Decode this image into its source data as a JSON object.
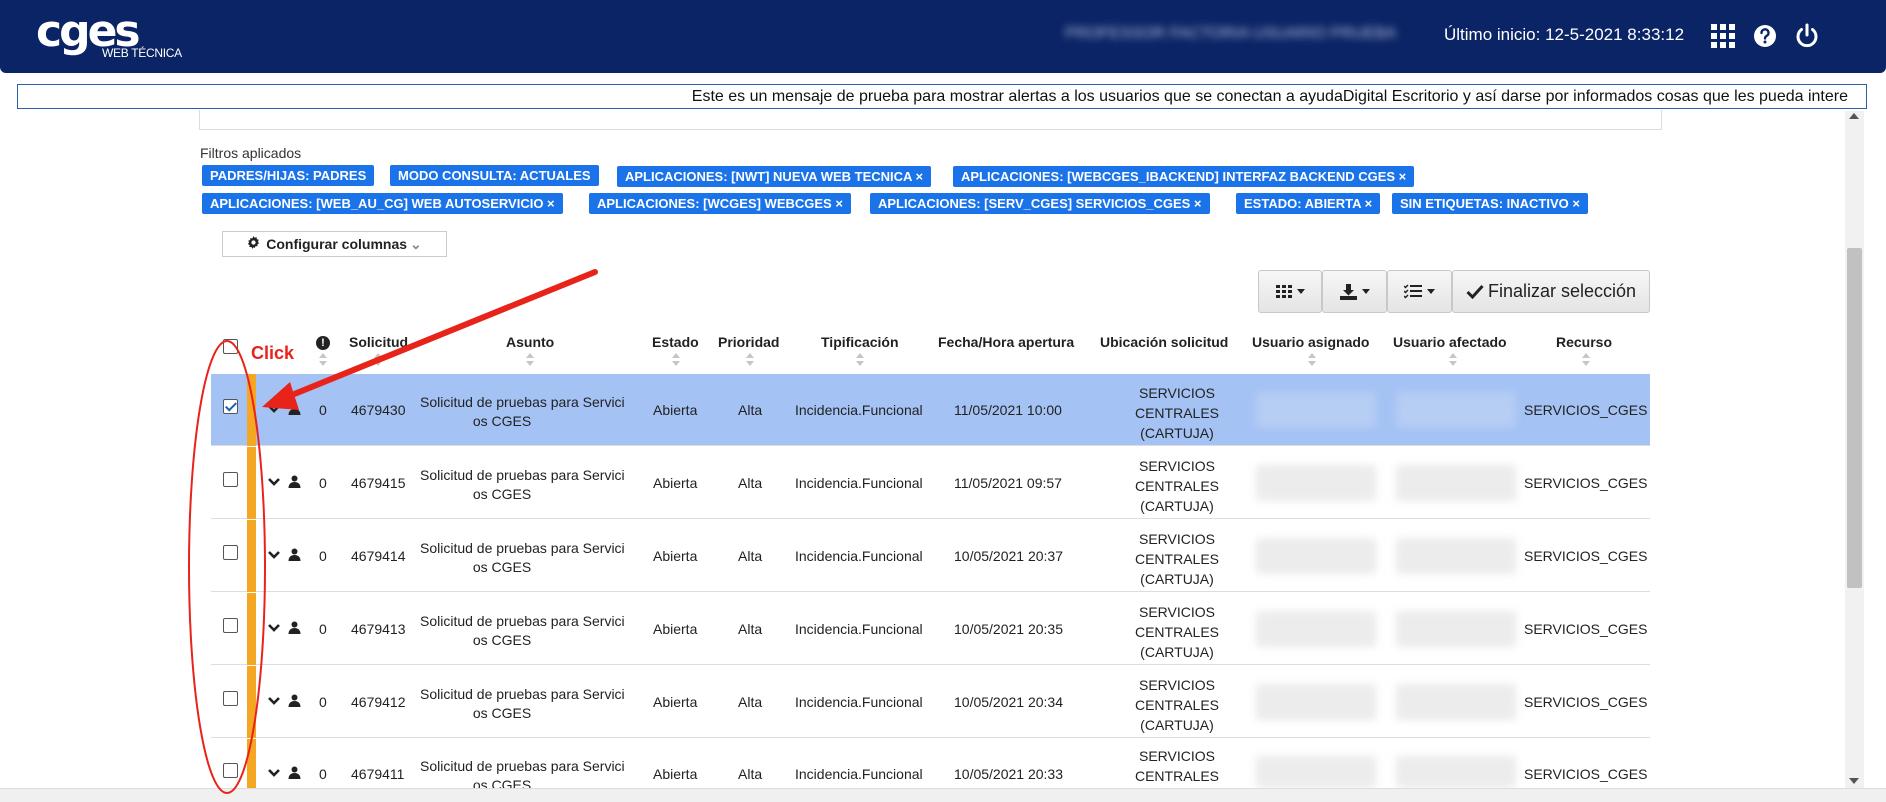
{
  "header": {
    "logo_main": "cges",
    "logo_sub": "WEB TÉCNICA",
    "user_name": "PROFESSOR FACTORIA USUARIO PRUEBA",
    "last_login": "Último inicio: 12-5-2021 8:33:12",
    "icons": [
      "apps-grid-icon",
      "help-icon",
      "power-icon"
    ]
  },
  "ticker": {
    "message": "Este es un mensaje de prueba para mostrar alertas a los usuarios que se conectan a ayudaDigital Escritorio y así darse por informados cosas que les pueda intere"
  },
  "filters": {
    "label": "Filtros aplicados",
    "chips": [
      "PADRES/HIJAS: PADRES",
      "MODO CONSULTA: ACTUALES",
      "APLICACIONES: [NWT] NUEVA WEB TECNICA ×",
      "APLICACIONES: [WEBCGES_IBACKEND] INTERFAZ BACKEND CGES ×",
      "APLICACIONES: [WEB_AU_CG] WEB AUTOSERVICIO ×",
      "APLICACIONES: [WCGES] WEBCGES ×",
      "APLICACIONES: [SERV_CGES] SERVICIOS_CGES ×",
      "ESTADO: ABIERTA ×",
      "SIN ETIQUETAS: INACTIVO ×"
    ]
  },
  "config_columns_label": "Configurar columnas",
  "toolbar": {
    "finalize_label": "Finalizar selección"
  },
  "table": {
    "columns": [
      "Solicitud",
      "Asunto",
      "Estado",
      "Prioridad",
      "Tipificación",
      "Fecha/Hora apertura",
      "Ubicación solicitud",
      "Usuario asignado",
      "Usuario afectado",
      "Recurso"
    ],
    "rows": [
      {
        "count": "0",
        "id": "4679430",
        "asunto_1": "Solicitud de pruebas para Servici",
        "asunto_2": "os CGES",
        "estado": "Abierta",
        "prioridad": "Alta",
        "tipificacion": "Incidencia.Funcional",
        "fecha": "11/05/2021 10:00",
        "ubicacion_1": "SERVICIOS",
        "ubicacion_2": "CENTRALES",
        "ubicacion_3": "(CARTUJA)",
        "recurso": "SERVICIOS_CGES",
        "checked": true
      },
      {
        "count": "0",
        "id": "4679415",
        "asunto_1": "Solicitud de pruebas para Servici",
        "asunto_2": "os CGES",
        "estado": "Abierta",
        "prioridad": "Alta",
        "tipificacion": "Incidencia.Funcional",
        "fecha": "11/05/2021 09:57",
        "ubicacion_1": "SERVICIOS",
        "ubicacion_2": "CENTRALES",
        "ubicacion_3": "(CARTUJA)",
        "recurso": "SERVICIOS_CGES",
        "checked": false
      },
      {
        "count": "0",
        "id": "4679414",
        "asunto_1": "Solicitud de pruebas para Servici",
        "asunto_2": "os CGES",
        "estado": "Abierta",
        "prioridad": "Alta",
        "tipificacion": "Incidencia.Funcional",
        "fecha": "10/05/2021 20:37",
        "ubicacion_1": "SERVICIOS",
        "ubicacion_2": "CENTRALES",
        "ubicacion_3": "(CARTUJA)",
        "recurso": "SERVICIOS_CGES",
        "checked": false
      },
      {
        "count": "0",
        "id": "4679413",
        "asunto_1": "Solicitud de pruebas para Servici",
        "asunto_2": "os CGES",
        "estado": "Abierta",
        "prioridad": "Alta",
        "tipificacion": "Incidencia.Funcional",
        "fecha": "10/05/2021 20:35",
        "ubicacion_1": "SERVICIOS",
        "ubicacion_2": "CENTRALES",
        "ubicacion_3": "(CARTUJA)",
        "recurso": "SERVICIOS_CGES",
        "checked": false
      },
      {
        "count": "0",
        "id": "4679412",
        "asunto_1": "Solicitud de pruebas para Servici",
        "asunto_2": "os CGES",
        "estado": "Abierta",
        "prioridad": "Alta",
        "tipificacion": "Incidencia.Funcional",
        "fecha": "10/05/2021 20:34",
        "ubicacion_1": "SERVICIOS",
        "ubicacion_2": "CENTRALES",
        "ubicacion_3": "(CARTUJA)",
        "recurso": "SERVICIOS_CGES",
        "checked": false
      },
      {
        "count": "0",
        "id": "4679411",
        "asunto_1": "Solicitud de pruebas para Servici",
        "asunto_2": "os CGES",
        "estado": "Abierta",
        "prioridad": "Alta",
        "tipificacion": "Incidencia.Funcional",
        "fecha": "10/05/2021 20:33",
        "ubicacion_1": "SERVICIOS",
        "ubicacion_2": "CENTRALES",
        "ubicacion_3": "",
        "recurso": "SERVICIOS_CGES",
        "checked": false
      }
    ]
  },
  "annotation": {
    "label": "Click",
    "color": "#e8241a"
  },
  "colors": {
    "header_bg": "#0b2466",
    "chip_bg": "#1a73e8",
    "selected_row": "#a4c2f4",
    "priority_bar": "#f5a623"
  }
}
